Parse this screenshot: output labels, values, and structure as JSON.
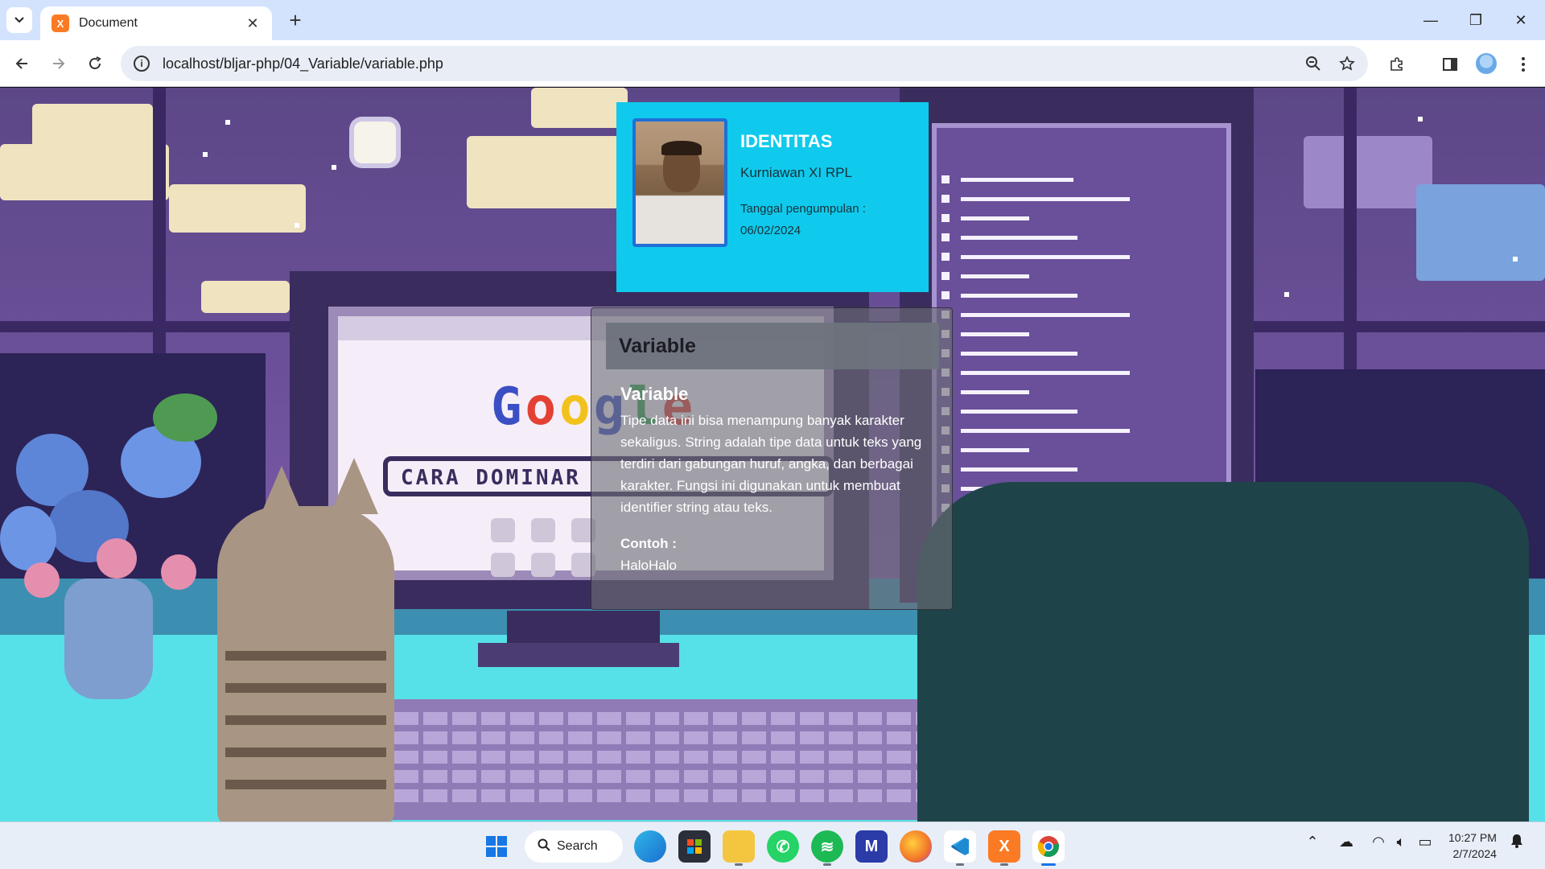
{
  "browser": {
    "tab_title": "Document",
    "tab_close": "✕",
    "new_tab": "+",
    "url": "localhost/bljar-php/04_Variable/variable.php",
    "window_controls": {
      "minimize": "—",
      "restore": "❐",
      "close": "✕"
    }
  },
  "identitas": {
    "title": "IDENTITAS",
    "name": "Kurniawan XI RPL",
    "date_label": "Tanggal pengumpulan :",
    "date": "06/02/2024"
  },
  "variable_card": {
    "header": "Variable",
    "heading": "Variable",
    "description": "Tipe data ini bisa menampung banyak karakter sekaligus. String adalah tipe data untuk teks yang terdiri dari gabungan huruf, angka, dan berbagai karakter. Fungsi ini digunakan untuk membuat identifier string atau teks.",
    "example_label": "Contoh :",
    "example_value": "HaloHalo"
  },
  "scene": {
    "google_logo": "Google",
    "search_text": "CARA DOMINAR"
  },
  "taskbar": {
    "search_label": "Search",
    "time": "10:27 PM",
    "date": "2/7/2024",
    "apps": [
      "windows-start",
      "edge",
      "microsoft-store",
      "file-explorer",
      "whatsapp",
      "spotify",
      "mindmanager",
      "firefox",
      "vscode",
      "xampp",
      "chrome"
    ]
  },
  "colors": {
    "identitas_bg": "#0fcaec",
    "photo_border": "#1f6fd6",
    "xampp_orange": "#fb7a24",
    "chrome_accent": "#1a73e8"
  }
}
